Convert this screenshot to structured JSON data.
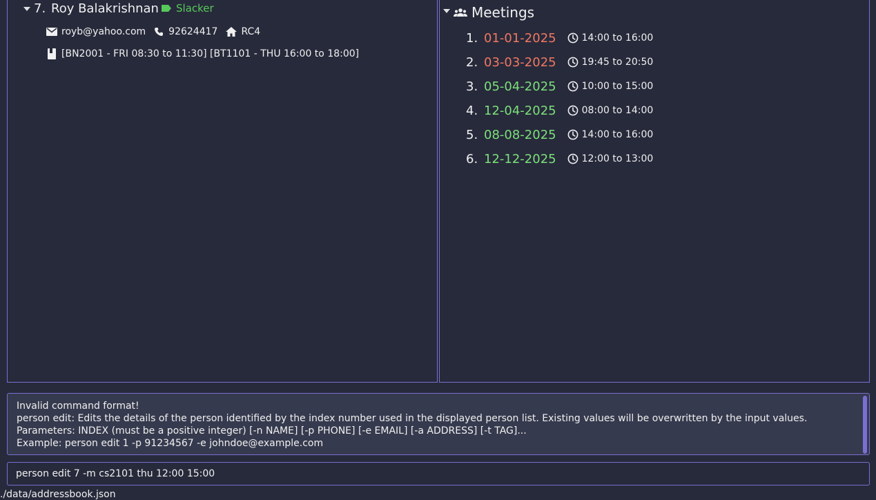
{
  "persons": [
    {
      "index": "7.",
      "name": "Roy Balakrishnan",
      "tag": "Slacker",
      "email": "royb@yahoo.com",
      "phone": "92624417",
      "address": "RC4",
      "modules": "[BN2001 - FRI 08:30 to 11:30] [BT1101 - THU 16:00 to 18:00]"
    }
  ],
  "meetings_panel": {
    "title": "Meetings",
    "items": [
      {
        "index": "1.",
        "date": "01-01-2025",
        "time": "14:00 to 16:00",
        "status": "past"
      },
      {
        "index": "2.",
        "date": "03-03-2025",
        "time": "19:45 to 20:50",
        "status": "past"
      },
      {
        "index": "3.",
        "date": "05-04-2025",
        "time": "10:00 to 15:00",
        "status": "future"
      },
      {
        "index": "4.",
        "date": "12-04-2025",
        "time": "08:00 to 14:00",
        "status": "future"
      },
      {
        "index": "5.",
        "date": "08-08-2025",
        "time": "14:00 to 16:00",
        "status": "future"
      },
      {
        "index": "6.",
        "date": "12-12-2025",
        "time": "12:00 to 13:00",
        "status": "future"
      }
    ]
  },
  "result": {
    "lines": [
      "Invalid command format!",
      "person edit: Edits the details of the person identified by the index number used in the displayed person list. Existing values will be overwritten by the input values.",
      "Parameters: INDEX (must be a positive integer) [-n NAME] [-p PHONE] [-e EMAIL] [-a ADDRESS] [-t TAG]...",
      "Example: person edit 1 -p 91234567 -e johndoe@example.com"
    ]
  },
  "command": {
    "value": "person edit 7 -m cs2101 thu 12:00 15:00"
  },
  "status_bar": {
    "path": "./data/addressbook.json"
  },
  "colors": {
    "accent": "#7a6fd2",
    "tag": "#57c95a",
    "past_meeting": "#f07862",
    "future_meeting": "#7de07a",
    "background": "#272a3b"
  },
  "icons": [
    "chevron-down-icon",
    "tag-icon",
    "email-icon",
    "phone-icon",
    "home-icon",
    "book-icon",
    "people-icon",
    "clock-icon"
  ]
}
